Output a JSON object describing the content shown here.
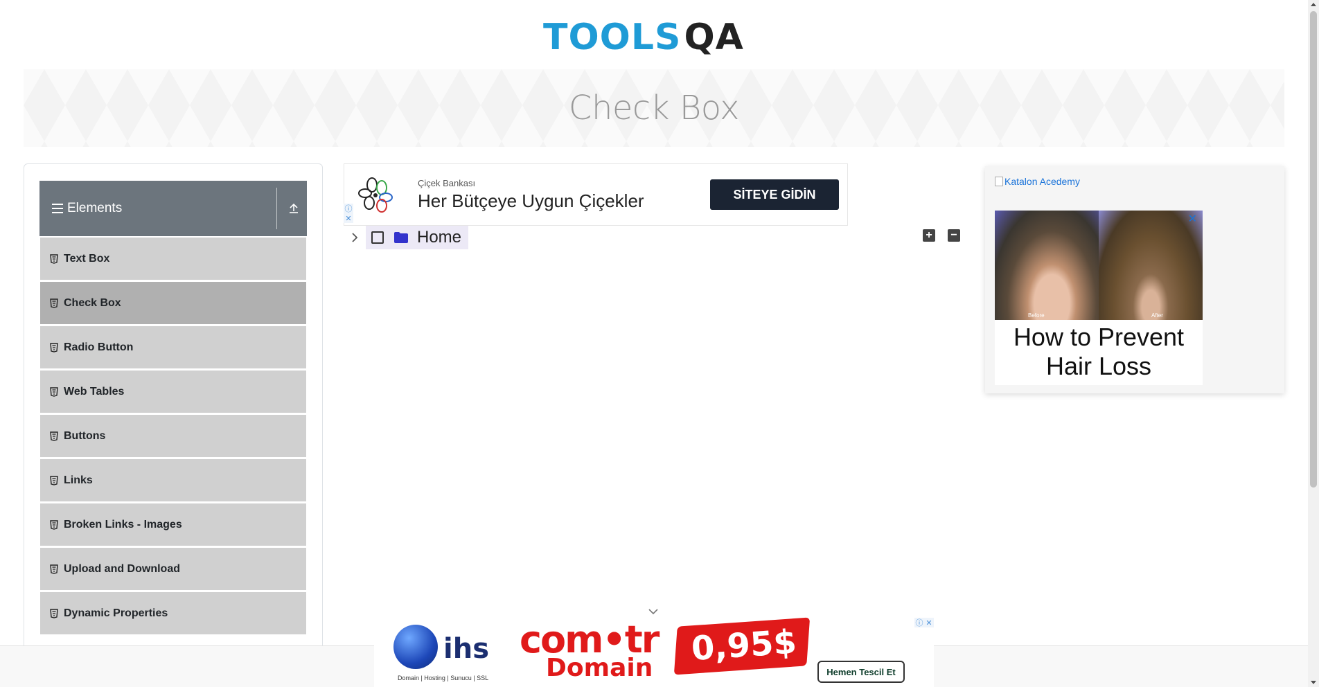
{
  "logo": {
    "left": "TOOLS",
    "right": "QA"
  },
  "banner": {
    "title": "Check Box"
  },
  "sidebar": {
    "group_title": "Elements",
    "items": [
      {
        "label": "Text Box"
      },
      {
        "label": "Check Box",
        "active": true
      },
      {
        "label": "Radio Button"
      },
      {
        "label": "Web Tables"
      },
      {
        "label": "Buttons"
      },
      {
        "label": "Links"
      },
      {
        "label": "Broken Links - Images"
      },
      {
        "label": "Upload and Download"
      },
      {
        "label": "Dynamic Properties"
      }
    ]
  },
  "ad_top": {
    "brand": "Çiçek Bankası",
    "headline": "Her Bütçeye Uygun Çiçekler",
    "cta": "SİTEYE GİDİN",
    "info": "ⓘ",
    "close": "✕"
  },
  "tree": {
    "root_label": "Home",
    "expand_all": "+",
    "collapse_all": "−"
  },
  "ad_right": {
    "alt_text": "Katalon Acedemy",
    "before_tag": "Before",
    "after_tag": "After",
    "close": "✕",
    "headline": "How to Prevent Hair Loss"
  },
  "ad_bottom": {
    "ihs": "ihs",
    "ihs_sub": "Domain | Hosting | Sunucu | SSL",
    "comtr": "com•tr",
    "domain": "Domain",
    "price": "0,95$",
    "register": "Hemen Tescil Et",
    "info": "ⓘ",
    "close": "✕"
  },
  "colors": {
    "brand_blue": "#1f9bd6",
    "sidebar_header": "#6c757d",
    "menu_item": "#d0d0d0",
    "menu_item_active": "#b0b0b0",
    "tree_highlight": "#ece9f6",
    "folder": "#3333cc",
    "ad_cta": "#1b2433",
    "ad_red": "#e01a1a"
  }
}
